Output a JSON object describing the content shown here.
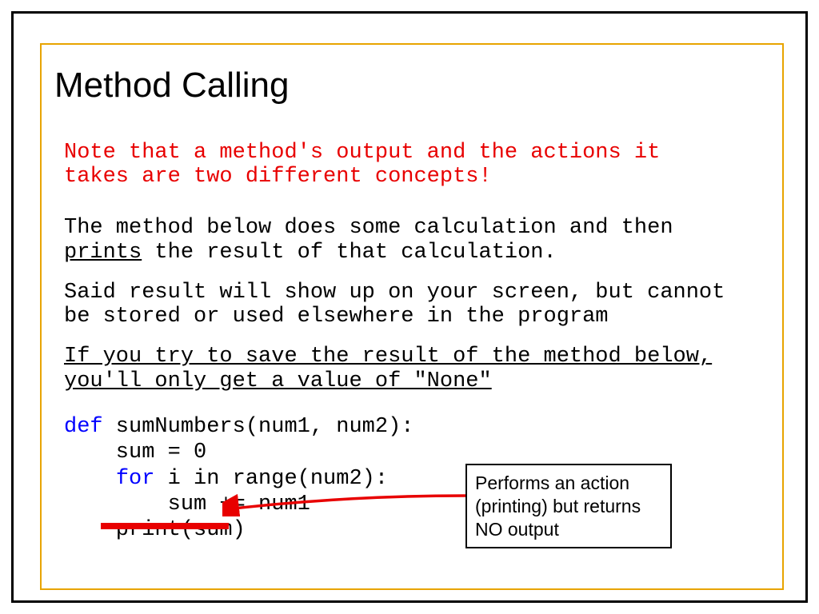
{
  "title": "Method Calling",
  "note_red": "Note that a method's output and the actions it takes are two different concepts!",
  "para1_a": "The method below does some calculation and then ",
  "para1_b": "prints",
  "para1_c": " the result of that calculation.",
  "para2": "Said result will show up on your screen, but cannot be stored or used elsewhere in the program",
  "para3": "If you try to save the result of the method below, you'll only get a value of \"None\"",
  "code": {
    "kw_def": "def",
    "sig": " sumNumbers(num1, num2):",
    "l2": "    sum = 0",
    "kw_for": "for",
    "l3_pre": "    ",
    "l3_post": " i in range(num2):",
    "l4": "        sum += num1",
    "l5": "    print(sum)"
  },
  "callout": "Performs an action (printing) but returns NO output"
}
